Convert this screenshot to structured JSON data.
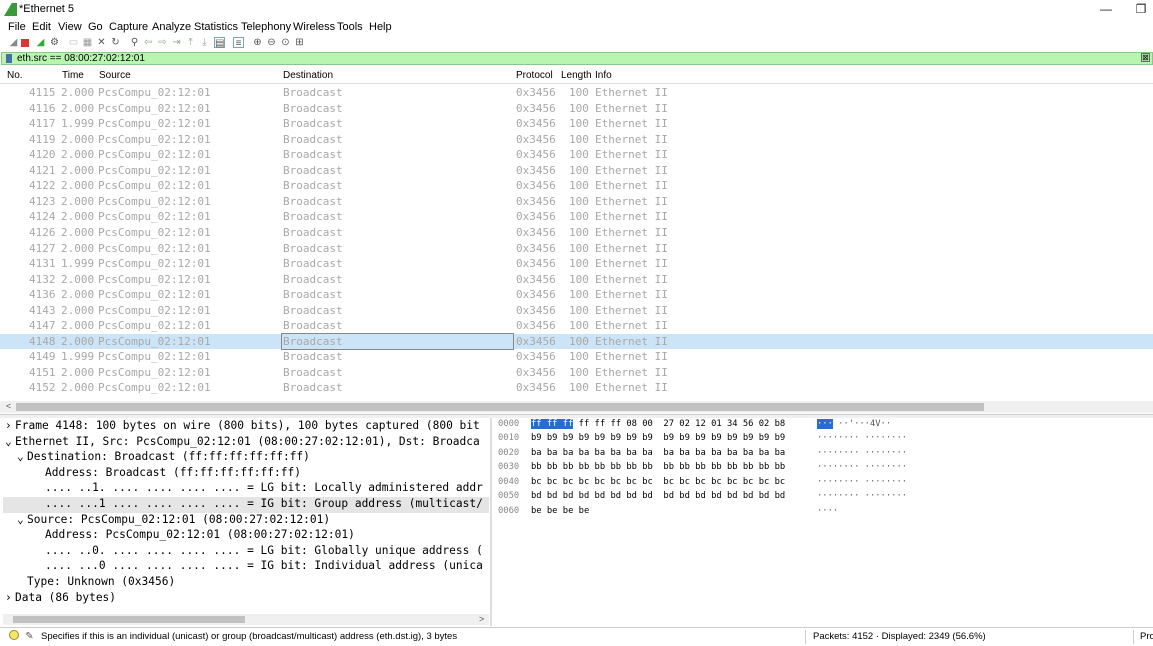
{
  "window": {
    "title": "*Ethernet 5",
    "minimize": "—",
    "restore": "❐"
  },
  "menu": [
    "File",
    "Edit",
    "View",
    "Go",
    "Capture",
    "Analyze",
    "Statistics",
    "Telephony",
    "Wireless",
    "Tools",
    "Help"
  ],
  "filter": {
    "value": "eth.src == 08:00:27:02:12:01",
    "clear": "⊠"
  },
  "columns": {
    "no": "No.",
    "time": "Time",
    "source": "Source",
    "destination": "Destination",
    "protocol": "Protocol",
    "length": "Length",
    "info": "Info"
  },
  "packets": [
    {
      "no": "4115",
      "time": "2.000",
      "source": "PcsCompu_02:12:01",
      "destination": "Broadcast",
      "protocol": "0x3456",
      "length": "100",
      "info": "Ethernet II"
    },
    {
      "no": "4116",
      "time": "2.000",
      "source": "PcsCompu_02:12:01",
      "destination": "Broadcast",
      "protocol": "0x3456",
      "length": "100",
      "info": "Ethernet II"
    },
    {
      "no": "4117",
      "time": "1.999",
      "source": "PcsCompu_02:12:01",
      "destination": "Broadcast",
      "protocol": "0x3456",
      "length": "100",
      "info": "Ethernet II"
    },
    {
      "no": "4119",
      "time": "2.000",
      "source": "PcsCompu_02:12:01",
      "destination": "Broadcast",
      "protocol": "0x3456",
      "length": "100",
      "info": "Ethernet II"
    },
    {
      "no": "4120",
      "time": "2.000",
      "source": "PcsCompu_02:12:01",
      "destination": "Broadcast",
      "protocol": "0x3456",
      "length": "100",
      "info": "Ethernet II"
    },
    {
      "no": "4121",
      "time": "2.000",
      "source": "PcsCompu_02:12:01",
      "destination": "Broadcast",
      "protocol": "0x3456",
      "length": "100",
      "info": "Ethernet II"
    },
    {
      "no": "4122",
      "time": "2.000",
      "source": "PcsCompu_02:12:01",
      "destination": "Broadcast",
      "protocol": "0x3456",
      "length": "100",
      "info": "Ethernet II"
    },
    {
      "no": "4123",
      "time": "2.000",
      "source": "PcsCompu_02:12:01",
      "destination": "Broadcast",
      "protocol": "0x3456",
      "length": "100",
      "info": "Ethernet II"
    },
    {
      "no": "4124",
      "time": "2.000",
      "source": "PcsCompu_02:12:01",
      "destination": "Broadcast",
      "protocol": "0x3456",
      "length": "100",
      "info": "Ethernet II"
    },
    {
      "no": "4126",
      "time": "2.000",
      "source": "PcsCompu_02:12:01",
      "destination": "Broadcast",
      "protocol": "0x3456",
      "length": "100",
      "info": "Ethernet II"
    },
    {
      "no": "4127",
      "time": "2.000",
      "source": "PcsCompu_02:12:01",
      "destination": "Broadcast",
      "protocol": "0x3456",
      "length": "100",
      "info": "Ethernet II"
    },
    {
      "no": "4131",
      "time": "1.999",
      "source": "PcsCompu_02:12:01",
      "destination": "Broadcast",
      "protocol": "0x3456",
      "length": "100",
      "info": "Ethernet II"
    },
    {
      "no": "4132",
      "time": "2.000",
      "source": "PcsCompu_02:12:01",
      "destination": "Broadcast",
      "protocol": "0x3456",
      "length": "100",
      "info": "Ethernet II"
    },
    {
      "no": "4136",
      "time": "2.000",
      "source": "PcsCompu_02:12:01",
      "destination": "Broadcast",
      "protocol": "0x3456",
      "length": "100",
      "info": "Ethernet II"
    },
    {
      "no": "4143",
      "time": "2.000",
      "source": "PcsCompu_02:12:01",
      "destination": "Broadcast",
      "protocol": "0x3456",
      "length": "100",
      "info": "Ethernet II"
    },
    {
      "no": "4147",
      "time": "2.000",
      "source": "PcsCompu_02:12:01",
      "destination": "Broadcast",
      "protocol": "0x3456",
      "length": "100",
      "info": "Ethernet II"
    },
    {
      "no": "4148",
      "time": "2.000",
      "source": "PcsCompu_02:12:01",
      "destination": "Broadcast",
      "protocol": "0x3456",
      "length": "100",
      "info": "Ethernet II"
    },
    {
      "no": "4149",
      "time": "1.999",
      "source": "PcsCompu_02:12:01",
      "destination": "Broadcast",
      "protocol": "0x3456",
      "length": "100",
      "info": "Ethernet II"
    },
    {
      "no": "4151",
      "time": "2.000",
      "source": "PcsCompu_02:12:01",
      "destination": "Broadcast",
      "protocol": "0x3456",
      "length": "100",
      "info": "Ethernet II"
    },
    {
      "no": "4152",
      "time": "2.000",
      "source": "PcsCompu_02:12:01",
      "destination": "Broadcast",
      "protocol": "0x3456",
      "length": "100",
      "info": "Ethernet II"
    }
  ],
  "selected_packet": "4148",
  "details": [
    {
      "arrow": "›",
      "text": "Frame 4148: 100 bytes on wire (800 bits), 100 bytes captured (800 bit"
    },
    {
      "arrow": "⌄",
      "text": "Ethernet II, Src: PcsCompu_02:12:01 (08:00:27:02:12:01), Dst: Broadca"
    },
    {
      "arrow": "⌄",
      "text": "Destination: Broadcast (ff:ff:ff:ff:ff:ff)"
    },
    {
      "arrow": "",
      "text": "Address: Broadcast (ff:ff:ff:ff:ff:ff)"
    },
    {
      "arrow": "",
      "text": ".... ..1. .... .... .... .... = LG bit: Locally administered addr"
    },
    {
      "arrow": "",
      "text": ".... ...1 .... .... .... .... = IG bit: Group address (multicast/"
    },
    {
      "arrow": "⌄",
      "text": "Source: PcsCompu_02:12:01 (08:00:27:02:12:01)"
    },
    {
      "arrow": "",
      "text": "Address: PcsCompu_02:12:01 (08:00:27:02:12:01)"
    },
    {
      "arrow": "",
      "text": ".... ..0. .... .... .... .... = LG bit: Globally unique address ("
    },
    {
      "arrow": "",
      "text": ".... ...0 .... .... .... .... = IG bit: Individual address (unica"
    },
    {
      "arrow": "",
      "text": "Type: Unknown (0x3456)"
    },
    {
      "arrow": "›",
      "text": "Data (86 bytes)"
    }
  ],
  "hex": [
    {
      "offset": "0000",
      "hl": "ff ff ff",
      "bytes": " ff ff ff 08 00  27 02 12 01 34 56 02 b8",
      "ascii_hl": "···",
      "ascii": "··· ··'···4V··"
    },
    {
      "offset": "0010",
      "hl": "",
      "bytes": "b9 b9 b9 b9 b9 b9 b9 b9  b9 b9 b9 b9 b9 b9 b9 b9",
      "ascii_hl": "",
      "ascii": "········ ········"
    },
    {
      "offset": "0020",
      "hl": "",
      "bytes": "ba ba ba ba ba ba ba ba  ba ba ba ba ba ba ba ba",
      "ascii_hl": "",
      "ascii": "········ ········"
    },
    {
      "offset": "0030",
      "hl": "",
      "bytes": "bb bb bb bb bb bb bb bb  bb bb bb bb bb bb bb bb",
      "ascii_hl": "",
      "ascii": "········ ········"
    },
    {
      "offset": "0040",
      "hl": "",
      "bytes": "bc bc bc bc bc bc bc bc  bc bc bc bc bc bc bc bc",
      "ascii_hl": "",
      "ascii": "········ ········"
    },
    {
      "offset": "0050",
      "hl": "",
      "bytes": "bd bd bd bd bd bd bd bd  bd bd bd bd bd bd bd bd",
      "ascii_hl": "",
      "ascii": "········ ········"
    },
    {
      "offset": "0060",
      "hl": "",
      "bytes": "be be be be",
      "ascii_hl": "",
      "ascii": "····"
    }
  ],
  "status": {
    "message": "Specifies if this is an individual (unicast) or group (broadcast/multicast) address (eth.dst.ig), 3 bytes",
    "packets": "Packets: 4152 · Displayed: 2349 (56.6%)",
    "profile": "Pro"
  }
}
